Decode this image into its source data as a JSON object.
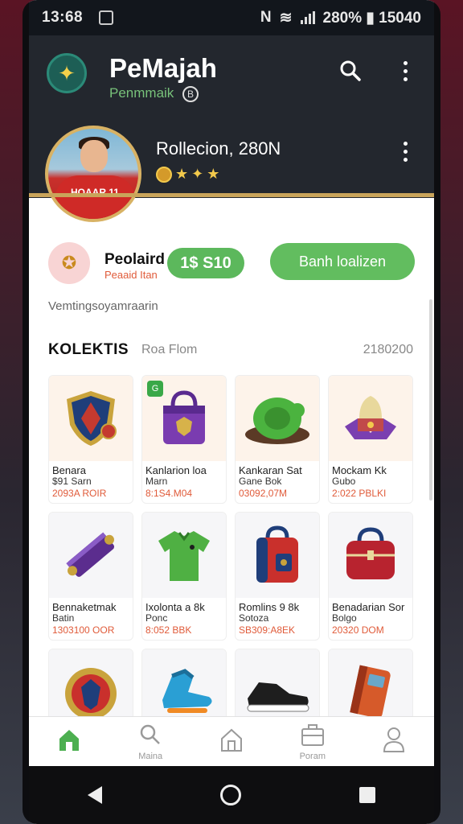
{
  "status_bar": {
    "time": "13:68",
    "right": "280% ▮ 15040",
    "signal_text": "N"
  },
  "header": {
    "title": "PeMajah",
    "subtitle": "Penmmaik",
    "subtitle_badge": "B",
    "logo_icon": "trophy-icon"
  },
  "profile": {
    "name": "Rollecion, 280N",
    "jersey_text": "HOAAR 11",
    "badges": [
      "coin",
      "★",
      "✦",
      "★"
    ]
  },
  "rank": {
    "name": "Peolaird",
    "sub": "Peaaid Itan",
    "price": "1$ S10",
    "action": "Banh loalizen"
  },
  "note": "Vemtingsoyamraarin",
  "collection": {
    "title": "KOLEKTIS",
    "sub": "Roa Flom",
    "count": "2180200"
  },
  "cards": [
    {
      "name": "Benara",
      "sub": "$91 Sarn",
      "price": "2093A ROIR",
      "art": "shield-crest",
      "colors": [
        "#1f3e7a",
        "#c9a33c",
        "#c43a2f"
      ],
      "tag": ""
    },
    {
      "name": "Kanlarion loa",
      "sub": "Marn",
      "price": "8:1S4.M04",
      "art": "bag",
      "colors": [
        "#5a2a8f",
        "#7a3cb0",
        "#d7b24a"
      ],
      "tag": "G"
    },
    {
      "name": "Kankaran Sat",
      "sub": "Gane Bok",
      "price": "03092,07M",
      "art": "turtle",
      "colors": [
        "#4bb33f",
        "#2e7a24",
        "#5b3a26"
      ],
      "tag": ""
    },
    {
      "name": "Mockam Kk",
      "sub": "Gubo",
      "price": "2:022 PBLKI",
      "art": "crown",
      "colors": [
        "#e8d89c",
        "#c14a4a",
        "#7a3fb0"
      ],
      "tag": ""
    },
    {
      "name": "Bennaketmak",
      "sub": "Batin",
      "price": "1303100 OOR",
      "art": "scroll",
      "colors": [
        "#5b2d8e",
        "#8a5cc6",
        "#c9a33c"
      ],
      "tag": ""
    },
    {
      "name": "Ixolonta a 8k",
      "sub": "Ponc",
      "price": "8:052 BBK",
      "art": "shirt",
      "colors": [
        "#4fb043",
        "#2f7b28",
        "#1e1e1e"
      ],
      "tag": ""
    },
    {
      "name": "Romlins 9 8k",
      "sub": "Sotoza",
      "price": "SB309:A8EK",
      "art": "backpack",
      "colors": [
        "#c9302c",
        "#1f3e7a",
        "#c9a33c"
      ],
      "tag": ""
    },
    {
      "name": "Benadarian Sor",
      "sub": "Bolgo",
      "price": "20320 DOM",
      "art": "trunk",
      "colors": [
        "#b8232f",
        "#1f3e7a",
        "#e8d89c"
      ],
      "tag": ""
    },
    {
      "name": "",
      "sub": "",
      "price": "",
      "art": "medal",
      "colors": [
        "#c9a33c",
        "#c9302c",
        "#1f3e7a"
      ],
      "tag": ""
    },
    {
      "name": "",
      "sub": "",
      "price": "",
      "art": "skate",
      "colors": [
        "#2a9fd4",
        "#1c6f9a",
        "#f08a24"
      ],
      "tag": ""
    },
    {
      "name": "",
      "sub": "",
      "price": "",
      "art": "shoe",
      "colors": [
        "#1e1e1e",
        "#ffffff",
        "#777777"
      ],
      "tag": ""
    },
    {
      "name": "",
      "sub": "",
      "price": "",
      "art": "device",
      "colors": [
        "#d65a2a",
        "#9a3318",
        "#6aa7c9"
      ],
      "tag": ""
    }
  ],
  "bottom_nav": [
    {
      "label": "",
      "icon": "home-icon",
      "active": true
    },
    {
      "label": "Maina",
      "icon": "search-icon",
      "active": false
    },
    {
      "label": "",
      "icon": "house-outline-icon",
      "active": false
    },
    {
      "label": "Poram",
      "icon": "briefcase-icon",
      "active": false
    },
    {
      "label": "",
      "icon": "profile-icon",
      "active": false
    }
  ]
}
